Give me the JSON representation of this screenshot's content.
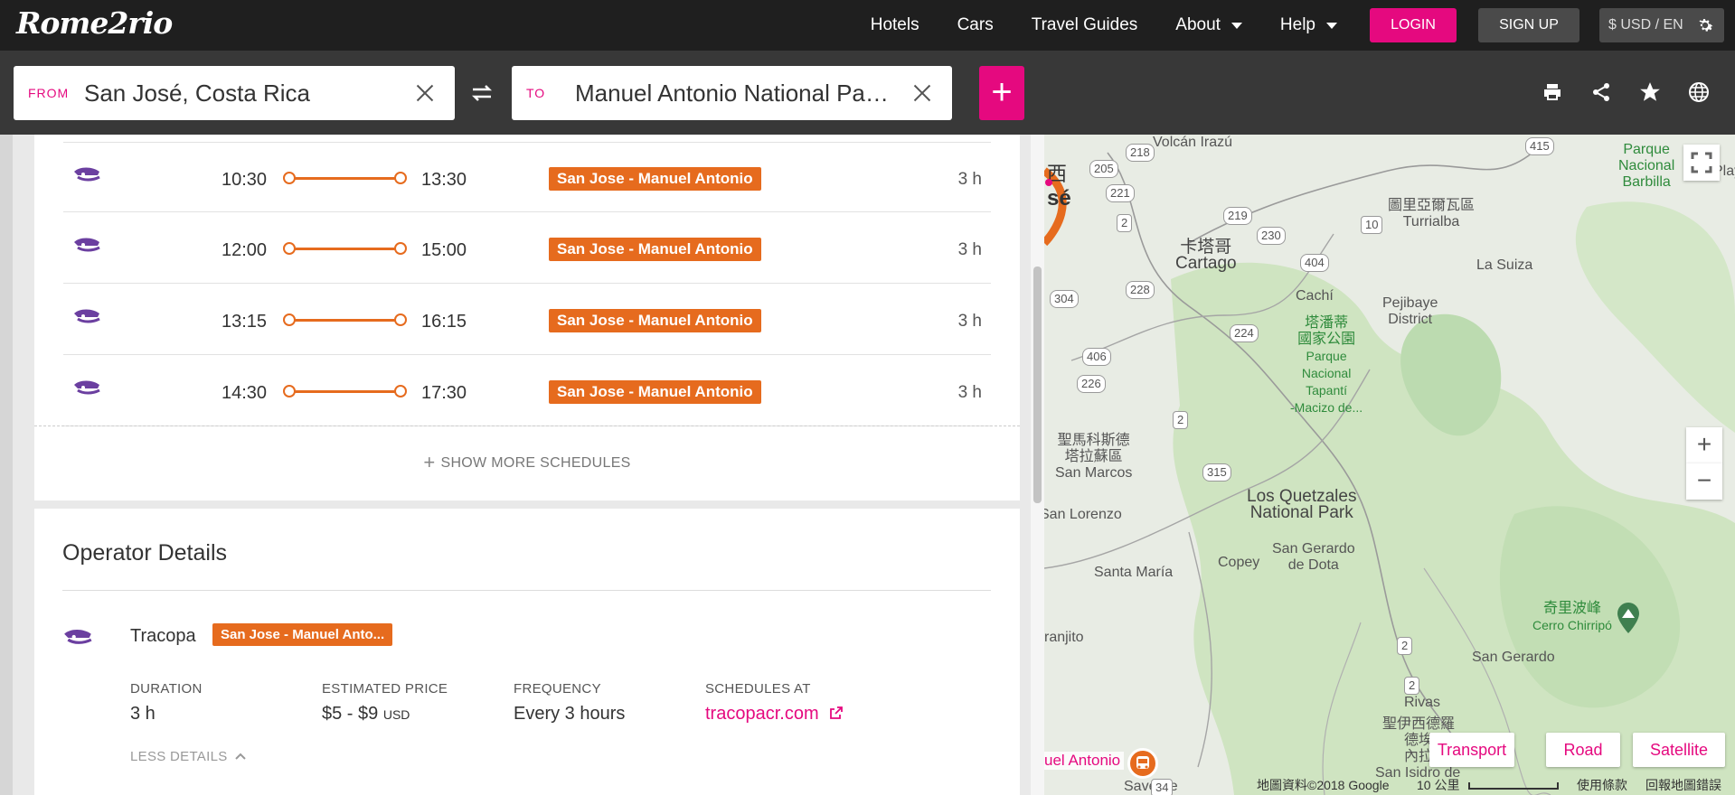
{
  "brand": {
    "logo": "Rome2rio"
  },
  "nav": {
    "hotels": "Hotels",
    "cars": "Cars",
    "guides": "Travel Guides",
    "about": "About",
    "help": "Help",
    "login": "LOGIN",
    "signup": "SIGN UP",
    "currency": "$ USD / EN"
  },
  "search": {
    "from_label": "FROM",
    "from_value": "San José, Costa Rica",
    "to_label": "TO",
    "to_value": "Manuel Antonio National Park, Costa Rica",
    "add": "+"
  },
  "schedules": [
    {
      "dep": "10:30",
      "arr": "13:30",
      "route": "San Jose - Manuel Antonio",
      "duration": "3 h"
    },
    {
      "dep": "12:00",
      "arr": "15:00",
      "route": "San Jose - Manuel Antonio",
      "duration": "3 h"
    },
    {
      "dep": "13:15",
      "arr": "16:15",
      "route": "San Jose - Manuel Antonio",
      "duration": "3 h"
    },
    {
      "dep": "14:30",
      "arr": "17:30",
      "route": "San Jose - Manuel Antonio",
      "duration": "3 h"
    }
  ],
  "show_more": "SHOW MORE SCHEDULES",
  "operator": {
    "title": "Operator Details",
    "name": "Tracopa",
    "route_badge": "San Jose - Manuel Anto...",
    "duration_label": "DURATION",
    "duration_value": "3 h",
    "price_label": "ESTIMATED PRICE",
    "price_value": "$5 - $9",
    "price_currency": "USD",
    "frequency_label": "FREQUENCY",
    "frequency_value": "Every 3 hours",
    "schedules_label": "SCHEDULES AT",
    "schedules_link": "tracopacr.com",
    "less_details": "LESS DETAILS"
  },
  "map": {
    "labels": {
      "cartago_zh": "卡塔哥",
      "cartago": "Cartago",
      "turrialba_zh": "圖里亞爾瓦區",
      "turrialba": "Turrialba",
      "la_suiza": "La Suiza",
      "pejibaye": "Pejibaye",
      "pejibaye_district": "District",
      "cachi": "Cachí",
      "tapanti_zh1": "塔潘蒂",
      "tapanti_zh2": "國家公園",
      "tapanti1": "Parque",
      "tapanti2": "Nacional",
      "tapanti3": "Tapantí",
      "tapanti4": "-Macizo de...",
      "san_marcos_zh1": "聖馬科斯德",
      "san_marcos_zh2": "塔拉蘇區",
      "san_marcos": "San Marcos",
      "quetzales1": "Los Quetzales",
      "quetzales2": "National Park",
      "san_lorenzo": "San Lorenzo",
      "san_gerardo_dota1": "San Gerardo",
      "san_gerardo_dota2": "de Dota",
      "santa_maria": "Santa María",
      "copey": "Copey",
      "chirripo_zh": "奇里波峰",
      "chirripo": "Cerro Chirripó",
      "san_gerardo": "San Gerardo",
      "rivas": "Rivas",
      "ranjito": "ranjito",
      "san_jose_zh": "西",
      "san_jose_frag": "sé",
      "barbilla1": "Parque",
      "barbilla2": "Nacional",
      "barbilla3": "Barbilla",
      "play": "Play",
      "perez_zh1": "聖伊西德羅",
      "perez_zh2": "德埃",
      "perez_zh3": "內拉",
      "isidro": "San Isidro de",
      "savegre": "Savegre",
      "volcan": "Volcán Irazú"
    },
    "roads": [
      "218",
      "415",
      "205",
      "221",
      "219",
      "230",
      "10",
      "2",
      "404",
      "228",
      "304",
      "224",
      "406",
      "226",
      "2",
      "315",
      "2",
      "2",
      "34"
    ],
    "zoom_in": "+",
    "zoom_out": "−",
    "types": {
      "transport": "Transport",
      "road": "Road",
      "satellite": "Satellite"
    },
    "destination": "uel Antonio",
    "footer": {
      "data": "地圖資料©2018 Google",
      "scale": "10 公里",
      "terms": "使用條款",
      "report": "回報地圖錯誤"
    }
  },
  "colors": {
    "accent": "#e5097f",
    "route": "#e66b1e",
    "nav_bg": "#1f1f1f",
    "search_bg": "#383838"
  }
}
